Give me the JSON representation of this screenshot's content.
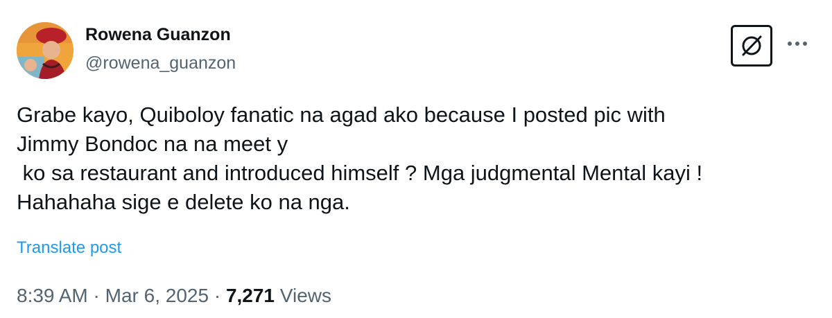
{
  "author": {
    "display_name": "Rowena Guanzon",
    "handle": "@rowena_guanzon",
    "avatar_icon": "profile-photo"
  },
  "actions": {
    "grok_icon": "grok-icon",
    "more_icon": "more-horizontal-icon"
  },
  "post": {
    "lines": [
      "Grabe kayo, Quiboloy fanatic na agad ako because I posted pic with",
      "Jimmy Bondoc na na meet y",
      " ko sa restaurant and introduced himself ? Mga judgmental Mental kayi !",
      "Hahahaha sige e delete ko na nga."
    ],
    "translate_label": "Translate post"
  },
  "meta": {
    "time": "8:39 AM",
    "separator": "·",
    "date": "Mar 6, 2025",
    "views_count": "7,271",
    "views_label": "Views"
  },
  "colors": {
    "text_primary": "#0f1419",
    "text_secondary": "#536471",
    "link": "#1d9bf0"
  }
}
